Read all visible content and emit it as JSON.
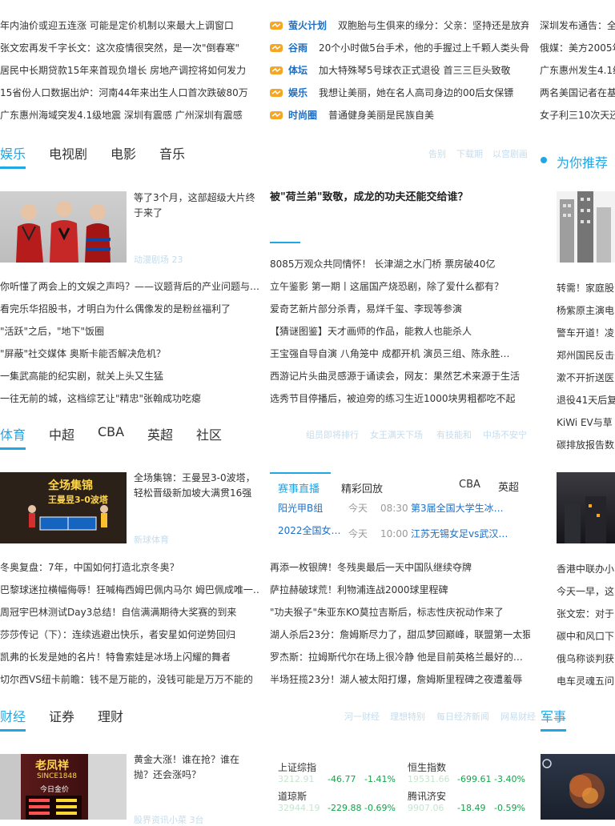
{
  "top": {
    "left_news": [
      "年内油价或迎五连涨 可能是定价机制以来最大上调窗口",
      "张文宏再发千字长文：这次疫情很突然，是一次\"倒春寒\"",
      "居民中长期贷款15年来首现负增长 房地产调控将如何发力",
      "15省份人口数据出炉：河南44年来出生人口首次跌破80万",
      "广东惠州海域突发4.1级地震 深圳有震感 广州深圳有震感"
    ],
    "tagged_news": [
      {
        "tag": "萤火计划",
        "text": "双胞胎与生俱来的缘分：父亲：坚持还是放弃？"
      },
      {
        "tag": "谷雨",
        "text": "20个小时做5台手术，他的手握过上千颗人类头骨"
      },
      {
        "tag": "体坛",
        "text": "加大特殊琴5号球衣正式退役 首三三巨头致敬"
      },
      {
        "tag": "娱乐",
        "text": "我想让美丽，她在名人高司身边的00后女保镖"
      },
      {
        "tag": "时尚圈",
        "text": "普通健身美丽是民族自美"
      }
    ],
    "right_news": [
      "深圳发布通告：全",
      "俄媒：美方2005年",
      "广东惠州发生4.1级",
      "两名美国记者在基",
      "女子利三10次天还"
    ]
  },
  "ent": {
    "tabs": [
      "娱乐",
      "电视剧",
      "电影",
      "音乐"
    ],
    "links": [
      "告别",
      "下载期",
      "以宫剧画"
    ],
    "recommend_title": "为你推荐",
    "feature_title": "等了3个月，这部超级大片终于来了",
    "feature_meta": "动漫剧场  23",
    "headline": "被\"荷兰弟\"致敬，成龙的功夫还能交给谁？",
    "left_list": [
      "你听懂了两会上的文娱之声吗？——议题背后的产业问题与…",
      "看完乐华招股书，才明白为什么偶像发的是粉丝福利了",
      "\"活跃\"之后，\"地下\"饭圈",
      "\"屏蔽\"社交媒体 奥斯卡能否解决危机？",
      "一集武高能的纪实剧，就关上头又生猛",
      "一往无前的城，这档综艺让\"精忠\"张翰成功吃瘪"
    ],
    "mid_list": [
      "8085万观众共同情怀！  长津湖之水门桥  票房破40亿",
      "立午鉴影  第一期丨这届国产烧恐剧，除了爱什么都有？",
      "爱奇艺新片部分杀青，易烊千玺、李现等参演",
      "【猜谜图鉴】天才画师的作品，能救人也能杀人",
      "王宝强自导自演  八角笼中  成都开机 演员三组、陈永胜…",
      "西游记片头曲灵感源于诵读会，网友：果然艺术来源于生活",
      "选秀节目停播后，被迫旁的练习生近1000块男粗都吃不起"
    ],
    "right_list": [
      "转需！家庭股",
      "杨紫原主演电",
      "警车开道！凌",
      "郑州国民反击恶",
      "漱不开折送医",
      "退役41天后复",
      "KiWi EV与草",
      "碳排放报告数"
    ]
  },
  "sports": {
    "tabs": [
      "体育",
      "中超",
      "CBA",
      "英超",
      "社区"
    ],
    "links": [
      "组员即将排行",
      "女王满天下场",
      "有技能和",
      "中场不安宁"
    ],
    "feature_title": "全场集锦：王曼昱3-0波塔，轻松晋级新加坡大满贯16强",
    "feature_meta": "新球体育",
    "feature_img_text": "全场集锦",
    "feature_img_sub": "王曼昱3-0波塔",
    "schedule_tabs": [
      "赛事直播",
      "精彩回放",
      "CBA",
      "英超"
    ],
    "schedule": [
      {
        "league": "阳光甲B组",
        "day": "今天",
        "time": "08:30",
        "match": "第3届全国大学生冰…"
      },
      {
        "league": "2022全国女…",
        "day": "今天",
        "time": "10:00",
        "match": "江苏无锡女足vs武汉…"
      }
    ],
    "left_list": [
      "冬奥复盘：7年，中国如何打造北京冬奥？",
      "巴黎球迷拉横幅侮辱！狂喊梅西姆巴佩内马尔 姆巴佩成唯一…",
      "周冠宇巴林测试Day3总结！自信满满期待大奖赛的到来",
      "莎莎传记（下）：连续逃避出快乐，者安星如何逆势回归",
      "凯弗的长发是她的名片！特鲁索娃是冰场上闪耀的舞者",
      "切尔西VS纽卡前瞻：钱不是万能的，没钱可能是万万不能的"
    ],
    "mid_list": [
      "再添一枚银牌！冬残奥最后一天中国队继续夺牌",
      "萨拉赫破球荒！利物浦连战2000球里程碑",
      "\"功夫猴子\"朱亚东KO莫拉吉斯后，标志性庆祝动作来了",
      "湖人杀后23分：詹姆斯尽力了，甜瓜梦回巅峰，联盟第一太狠",
      "罗杰斯：拉姆斯代尔在场上很冷静 他是目前英格兰最好的…",
      "半场狂揽23分！湖人被太阳打爆，詹姆斯里程碑之夜遭羞辱"
    ],
    "right_list": [
      "香港中联办小",
      "今天一早，这",
      "张文宏：对于",
      "碳中和风口下",
      "俄乌称谈判获",
      "电车灵魂五问"
    ]
  },
  "finance": {
    "tabs": [
      "财经",
      "证券",
      "理财"
    ],
    "links": [
      "河一财经",
      "理想特别",
      "每日经济新闻",
      "网易财经"
    ],
    "military_title": "军事",
    "feature_title": "黄金大涨！谁在抢？谁在抛？还会涨吗？",
    "feature_meta": "股界资讯小菜  3台",
    "shop_sign": "老凤祥",
    "shop_sub": "SINCE1848",
    "shop_price": "今日金价",
    "indices": [
      {
        "name": "上证综指",
        "value": "3212.91",
        "change": "-46.77",
        "pct": "-1.41%"
      },
      {
        "name": "恒生指数",
        "value": "19531.66",
        "change": "-699.61",
        "pct": "-3.40%"
      },
      {
        "name": "道琼斯",
        "value": "32944.19",
        "change": "-229.88",
        "pct": "-0.69%"
      },
      {
        "name": "腾讯济安",
        "value": "9907.06",
        "change": "-18.49",
        "pct": "-0.59%"
      }
    ]
  },
  "colors": {
    "accent": "#20a7e6",
    "tag": "#1e6fc4",
    "gain": "#16a34a"
  }
}
